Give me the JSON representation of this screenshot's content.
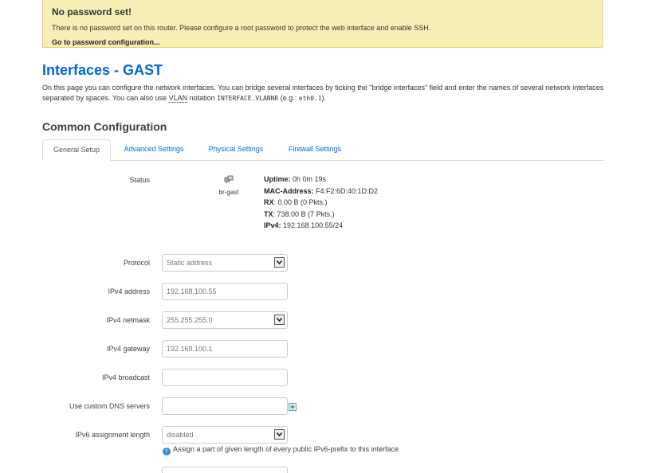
{
  "alert": {
    "title": "No password set!",
    "text": "There is no password set on this router. Please configure a root password to protect the web interface and enable SSH.",
    "link": "Go to password configuration..."
  },
  "page": {
    "title": "Interfaces - GAST",
    "desc_part1": "On this page you can configure the network interfaces. You can bridge several interfaces by ticking the \"bridge interfaces\" field and enter the names of several network interfaces separated by spaces. You can also use ",
    "desc_vlan": "VLAN",
    "desc_part2": " notation ",
    "desc_code1": "INTERFACE.VLANNR",
    "desc_part3": " (e.g.: ",
    "desc_code2": "eth0.1",
    "desc_part4": ")."
  },
  "section": {
    "title": "Common Configuration"
  },
  "tabs": [
    {
      "label": "General Setup",
      "active": true
    },
    {
      "label": "Advanced Settings",
      "active": false
    },
    {
      "label": "Physical Settings",
      "active": false
    },
    {
      "label": "Firewall Settings",
      "active": false
    }
  ],
  "status": {
    "label": "Status",
    "interface": "br-gast",
    "uptime_label": "Uptime:",
    "uptime": "0h 0m 19s",
    "mac_label": "MAC-Address:",
    "mac": "F4:F2:6D:40:1D:D2",
    "rx_label": "RX",
    "rx": "0.00 B (0 Pkts.)",
    "tx_label": "TX",
    "tx": "738.00 B (7 Pkts.)",
    "ipv4_label": "IPv4:",
    "ipv4": "192.168.100.55/24"
  },
  "form": {
    "protocol_label": "Protocol",
    "protocol_value": "Static address",
    "ipv4_address_label": "IPv4 address",
    "ipv4_address_value": "192.168.100.55",
    "ipv4_netmask_label": "IPv4 netmask",
    "ipv4_netmask_value": "255.255.255.0",
    "ipv4_gateway_label": "IPv4 gateway",
    "ipv4_gateway_value": "192.168.100.1",
    "ipv4_broadcast_label": "IPv4 broadcast",
    "ipv4_broadcast_value": "",
    "dns_label": "Use custom DNS servers",
    "dns_value": "",
    "ipv6_assign_label": "IPv6 assignment length",
    "ipv6_assign_value": "disabled",
    "ipv6_assign_hint": "Assign a part of given length of every public IPv6-prefix to this interface"
  },
  "colors": {
    "accent": "#0069d6",
    "alert_bg": "#f8efb6"
  }
}
